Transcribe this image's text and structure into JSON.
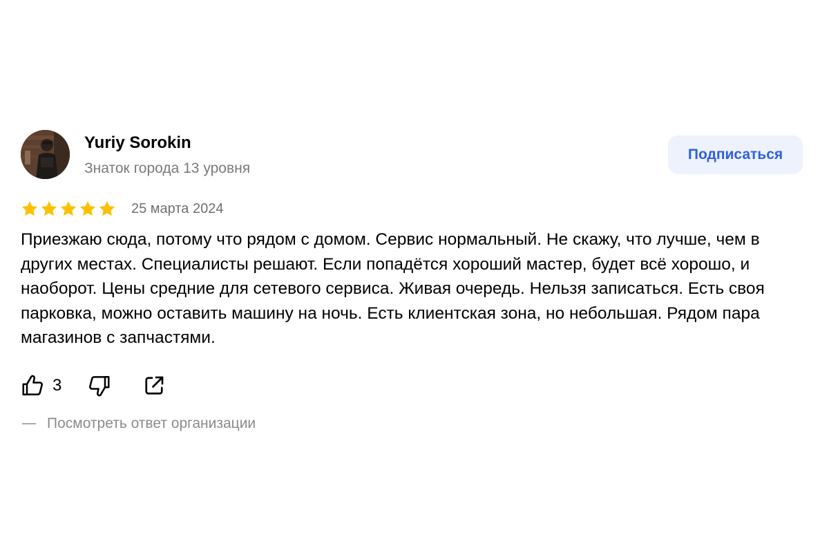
{
  "author": {
    "name": "Yuriy Sorokin",
    "level": "Знаток города 13 уровня"
  },
  "subscribe_label": "Подписаться",
  "review": {
    "rating": 5,
    "max_rating": 5,
    "date": "25 марта 2024",
    "text": "Приезжаю сюда, потому что рядом с домом. Сервис нормальный. Не скажу, что лучше, чем в других местах. Специалисты решают. Если попадётся хороший мастер, будет всё хорошо, и наоборот. Цены средние для сетевого сервиса. Живая очередь. Нельзя записаться. Есть своя парковка, можно оставить машину на ночь. Есть клиентская зона, но небольшая. Рядом пара магазинов с запчастями."
  },
  "actions": {
    "likes": "3",
    "like_icon": "thumbs-up-icon",
    "dislike_icon": "thumbs-down-icon",
    "share_icon": "share-icon"
  },
  "org_answer_label": "Посмотреть ответ организации",
  "colors": {
    "star": "#fcc000",
    "accent": "#2d5fe0",
    "subscribe_bg": "#eef2fc",
    "muted": "#7a7a7a"
  }
}
